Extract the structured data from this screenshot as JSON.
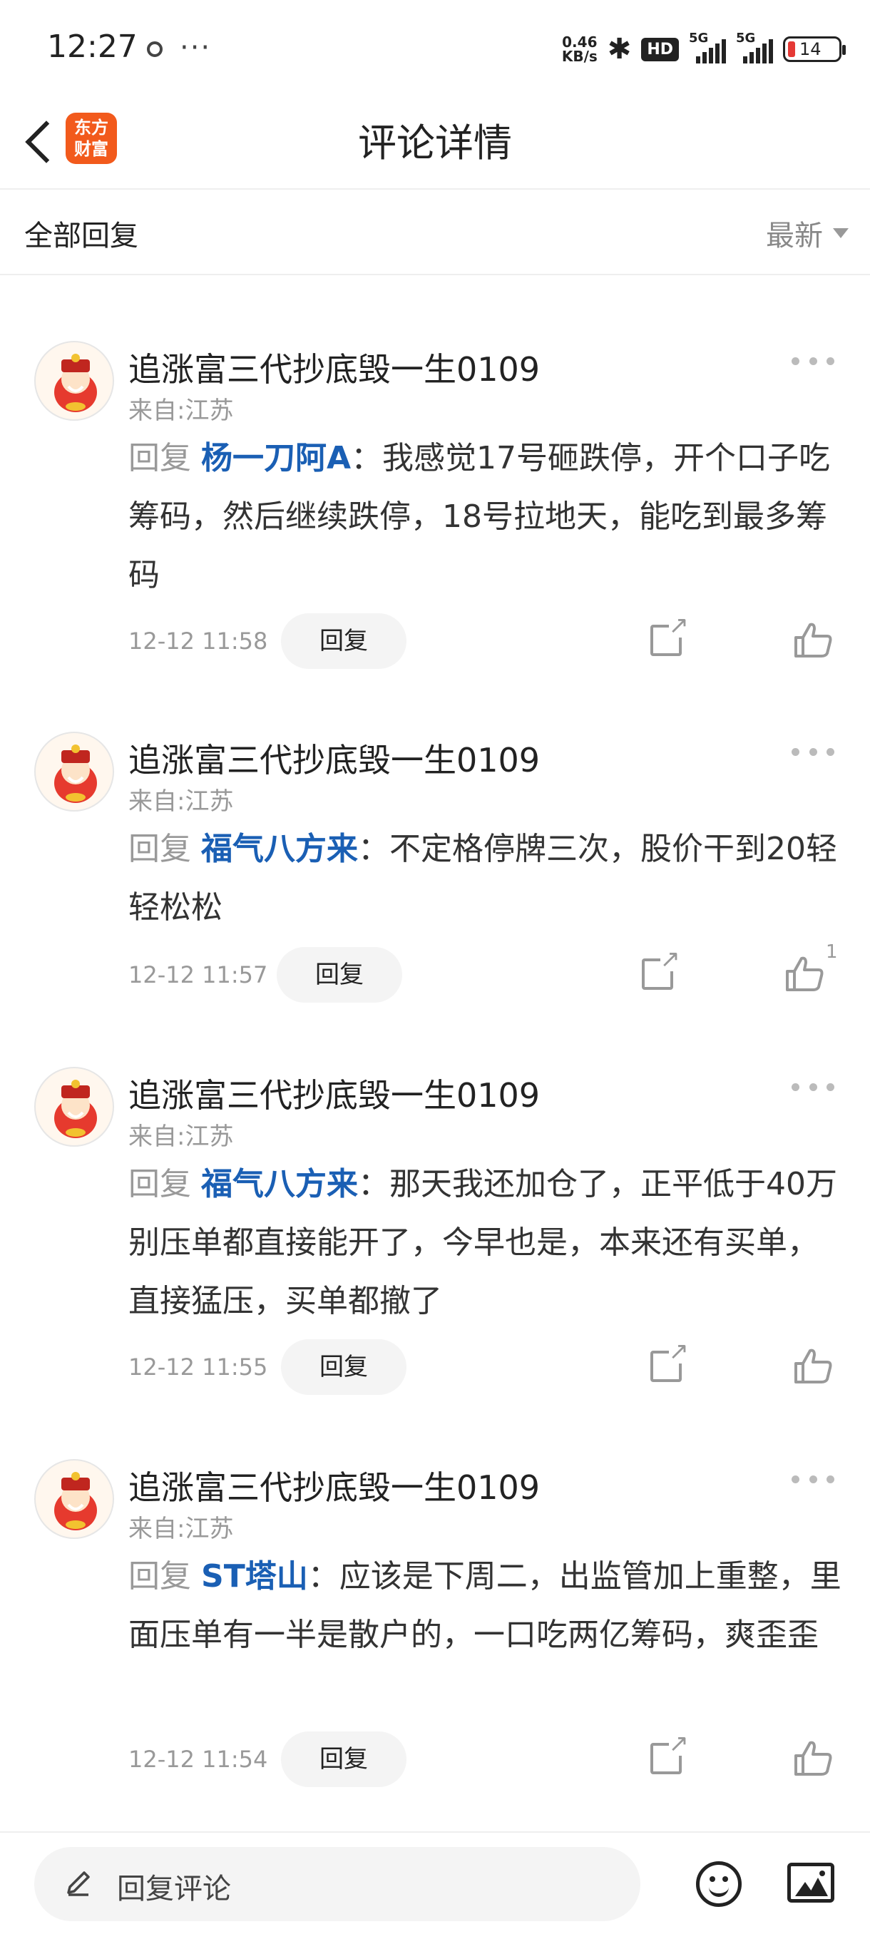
{
  "status_bar": {
    "time": "12:27",
    "speed_value": "0.46",
    "speed_unit": "KB/s",
    "hd": "HD",
    "network_1": "5G",
    "network_2": "5G",
    "battery": "14"
  },
  "header": {
    "logo_line1": "东方",
    "logo_line2": "财富",
    "title": "评论详情"
  },
  "filter": {
    "all_label": "全部回复",
    "sort_label": "最新"
  },
  "comments": [
    {
      "username": "追涨富三代抄底毁一生0109",
      "location": "来自:江苏",
      "reply_prefix": "回复",
      "mention": "杨一刀阿A",
      "text": "：我感觉17号砸跌停，开个口子吃筹码，然后继续跌停，18号拉地天，能吃到最多筹码",
      "time": "12-12 11:58",
      "reply_button": "回复",
      "likes": ""
    },
    {
      "username": "追涨富三代抄底毁一生0109",
      "location": "来自:江苏",
      "reply_prefix": "回复",
      "mention": "福气八方来",
      "text": "：不定格停牌三次，股价干到20轻轻松松",
      "time": "12-12 11:57",
      "reply_button": "回复",
      "likes": "1"
    },
    {
      "username": "追涨富三代抄底毁一生0109",
      "location": "来自:江苏",
      "reply_prefix": "回复",
      "mention": "福气八方来",
      "text": "：那天我还加仓了，正平低于40万别压单都直接能开了，今早也是，本来还有买单，直接猛压，买单都撤了",
      "time": "12-12 11:55",
      "reply_button": "回复",
      "likes": ""
    },
    {
      "username": "追涨富三代抄底毁一生0109",
      "location": "来自:江苏",
      "reply_prefix": "回复",
      "mention": "ST塔山",
      "text": "：应该是下周二，出监管加上重整，里面压单有一半是散户的，一口吃两亿筹码，爽歪歪",
      "time": "12-12 11:54",
      "reply_button": "回复",
      "likes": ""
    }
  ],
  "bottom_bar": {
    "input_placeholder": "回复评论"
  }
}
